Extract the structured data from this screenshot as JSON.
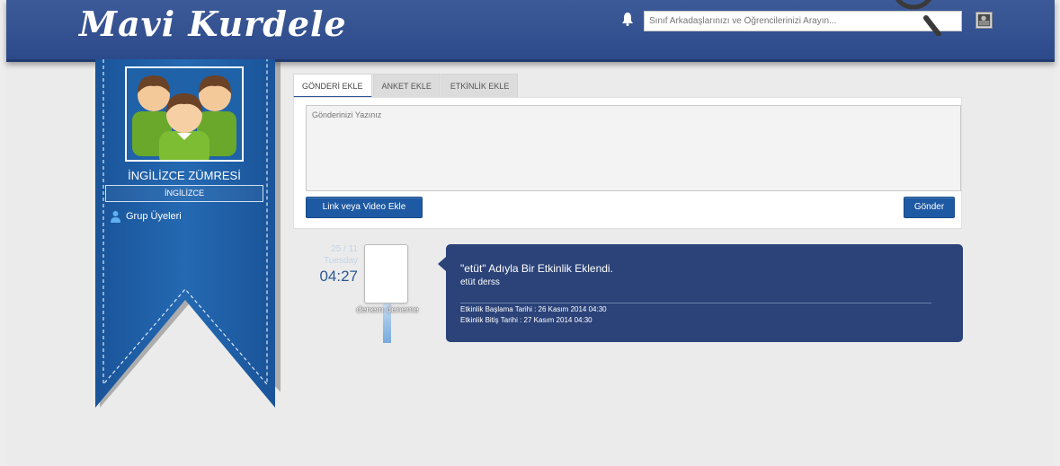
{
  "header": {
    "logo": "Mavi Kurdele",
    "search_placeholder": "Sınıf Arkadaşlarınızı ve Öğrencilerinizi Arayın...",
    "notification_icon": "bell-icon",
    "search_icon": "magnifier-icon"
  },
  "sidebar": {
    "group_name": "İNGİLİZCE ZÜMRESİ",
    "group_subject": "İNGİLİZCE",
    "members_label": "Grup Üyeleri",
    "members_icon": "user-icon"
  },
  "composer": {
    "tabs": [
      {
        "label": "GÖNDERİ EKLE",
        "active": true
      },
      {
        "label": "ANKET EKLE",
        "active": false
      },
      {
        "label": "ETKİNLİK EKLE",
        "active": false
      }
    ],
    "placeholder": "Gönderinizi Yazınız",
    "link_button": "Link veya Video Ekle",
    "send_button": "Gönder"
  },
  "timeline": {
    "day": "25 / 11",
    "weekday": "Tuesday",
    "time": "04:27",
    "author": "denem deneme",
    "event": {
      "title": "\"etüt\" Adıyla Bir Etkinlik Eklendi.",
      "description": "etüt derss",
      "start": "Etkinlik Başlama Tarihi : 26 Kasım 2014 04:30",
      "end": "Etkinlik Bitiş Tarihi : 27 Kasım 2014 04:30"
    }
  },
  "colors": {
    "header": "#2c4a8a",
    "ribbon": "#1f62a8",
    "accent": "#1e5aa3",
    "event_box": "#2b4379"
  }
}
